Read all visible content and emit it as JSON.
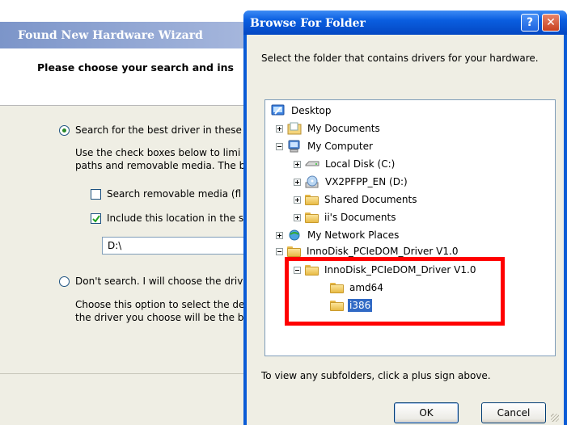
{
  "wizard": {
    "title": "Found New Hardware Wizard",
    "header": "Please choose your search and ins",
    "option_search": "Search for the best driver in these",
    "option_search_desc": [
      "Use the check boxes below to limi",
      "paths and removable media. The b"
    ],
    "check_removable": "Search removable media (fl",
    "check_include": "Include this location in the s",
    "location_value": "D:\\",
    "option_dont": "Don't search. I will choose the driv",
    "option_dont_desc": [
      "Choose this option to select the de",
      "the driver you choose will be the b"
    ]
  },
  "dialog": {
    "title": "Browse For Folder",
    "help_label": "?",
    "close_label": "✕",
    "description": "Select the folder that contains drivers for your hardware.",
    "tree": [
      {
        "label": "Desktop",
        "icon": "desktop-icon",
        "expander": "none"
      },
      {
        "label": "My Documents",
        "icon": "my-documents-icon",
        "expander": "plus"
      },
      {
        "label": "My Computer",
        "icon": "my-computer-icon",
        "expander": "minus"
      },
      {
        "label": "Local Disk (C:)",
        "icon": "local-disk-icon",
        "expander": "plus"
      },
      {
        "label": "VX2PFPP_EN (D:)",
        "icon": "cd-drive-icon",
        "expander": "plus"
      },
      {
        "label": "Shared Documents",
        "icon": "folder-icon",
        "expander": "plus"
      },
      {
        "label": "ii's Documents",
        "icon": "folder-icon",
        "expander": "plus"
      },
      {
        "label": "My Network Places",
        "icon": "network-places-icon",
        "expander": "plus"
      },
      {
        "label": "InnoDisk_PCIeDOM_Driver V1.0",
        "icon": "folder-icon",
        "expander": "minus"
      },
      {
        "label": "InnoDisk_PCIeDOM_Driver V1.0",
        "icon": "folder-icon",
        "expander": "minus"
      },
      {
        "label": "amd64",
        "icon": "folder-icon",
        "expander": "none"
      },
      {
        "label": "i386",
        "icon": "folder-icon",
        "expander": "none",
        "selected": true
      }
    ],
    "hint": "To view any subfolders, click a plus sign above.",
    "ok_label": "OK",
    "cancel_label": "Cancel"
  },
  "colors": {
    "highlight_box": "#ff0000",
    "selection": "#316ac5",
    "titlebar": "#0a5ee0"
  }
}
